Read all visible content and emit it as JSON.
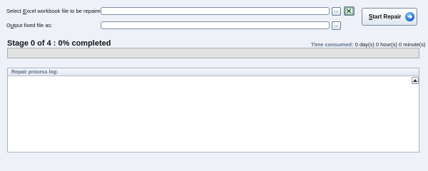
{
  "source": {
    "label_pre": "Select ",
    "label_accel": "E",
    "label_post": "xcel workbook file to be repaired:",
    "value": "",
    "browse_label": "...",
    "open_icon": "excel-icon"
  },
  "output": {
    "label_pre": "O",
    "label_accel": "u",
    "label_post": "tput fixed file as:",
    "value": "",
    "browse_label": "..."
  },
  "start_button": {
    "accel": "S",
    "label_post": "tart Repair",
    "icon": "arrow-right-circle-icon"
  },
  "status": {
    "stage_text": "Stage 0 of 4 :  0% completed",
    "progress_fraction": 0,
    "time_label": "Time consumed:",
    "time_value": "0 day(s) 0 hour(s) 0 minute(s)"
  },
  "log": {
    "title": "Repair process log:",
    "content": ""
  },
  "colors": {
    "background": "#eef2f8",
    "accent_blue": "#1f6fd0",
    "excel_green": "#1d6e3a"
  }
}
